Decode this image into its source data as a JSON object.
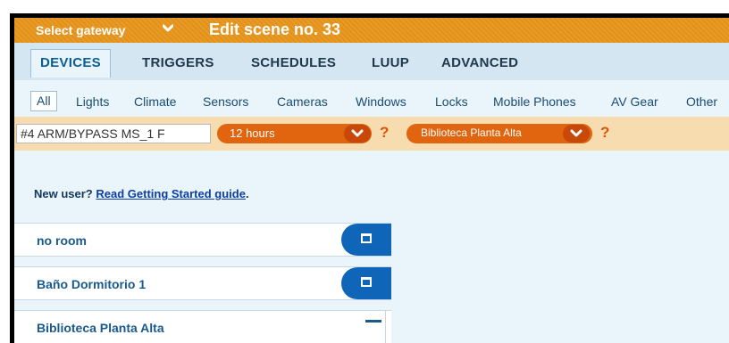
{
  "header": {
    "gateway_label": "Select gateway",
    "scene_title": "Edit scene no. 33"
  },
  "tabs": [
    {
      "label": "DEVICES"
    },
    {
      "label": "TRIGGERS"
    },
    {
      "label": "SCHEDULES"
    },
    {
      "label": "LUUP"
    },
    {
      "label": "ADVANCED"
    }
  ],
  "categories": [
    {
      "label": "All"
    },
    {
      "label": "Lights"
    },
    {
      "label": "Climate"
    },
    {
      "label": "Sensors"
    },
    {
      "label": "Cameras"
    },
    {
      "label": "Windows"
    },
    {
      "label": "Locks"
    },
    {
      "label": "Mobile Phones"
    },
    {
      "label": "AV Gear"
    },
    {
      "label": "Other"
    }
  ],
  "trigger": {
    "name_value": "#4 ARM/BYPASS MS_1 F",
    "duration_value": "12 hours",
    "room_value": "Biblioteca Planta Alta",
    "help_glyph": "?"
  },
  "help": {
    "prefix": "New user?",
    "link_text": "Read Getting Started guide",
    "suffix": "."
  },
  "rooms": [
    {
      "name": "no room",
      "state": "collapsed"
    },
    {
      "name": "Baño Dormitorio 1",
      "state": "collapsed"
    },
    {
      "name": "Biblioteca Planta Alta",
      "state": "expanded"
    }
  ],
  "colors": {
    "header_orange": "#e8961c",
    "pill_orange": "#e0650e",
    "room_button_blue": "#0f66b8",
    "tab_bar": "#d4e6f1",
    "content_bg": "#e9f4fb"
  }
}
